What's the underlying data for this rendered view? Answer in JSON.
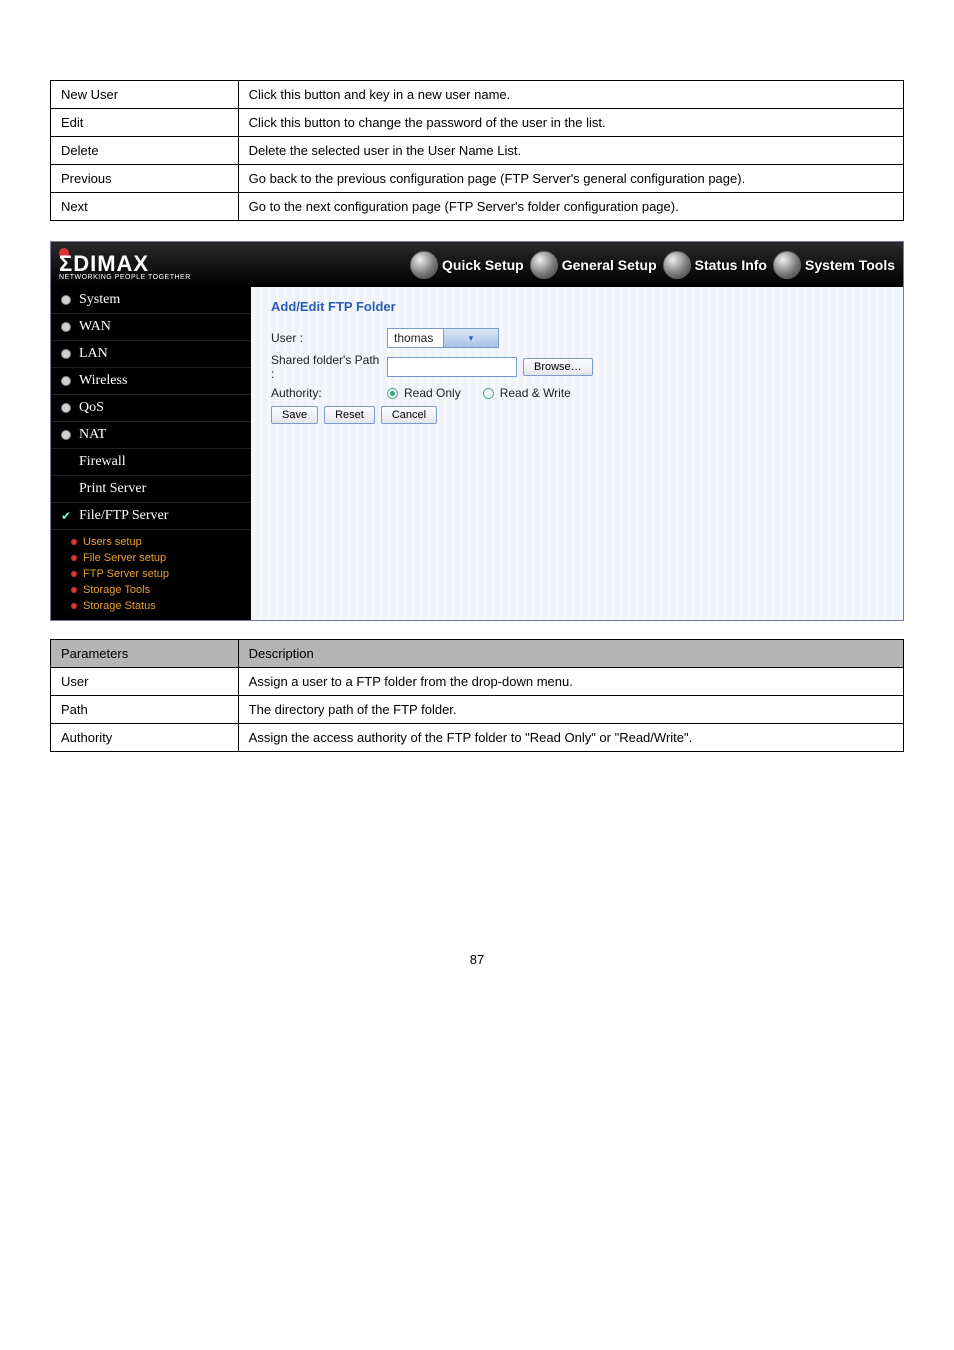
{
  "top_table": {
    "rows": [
      {
        "key": "New User",
        "val": "Click this button and key in a new user name."
      },
      {
        "key": "Edit",
        "val": "Click this button to change the password of the user in the list."
      },
      {
        "key": "Delete",
        "val": "Delete the selected user in the User Name List."
      },
      {
        "key": "Previous",
        "val": "Go back to the previous configuration page (FTP Server's general configuration page)."
      },
      {
        "key": "Next",
        "val": "Go to the next configuration page (FTP Server's folder configuration page)."
      }
    ]
  },
  "brand": {
    "name": "ΣDIMAX",
    "tagline": "NETWORKING PEOPLE TOGETHER"
  },
  "topnav": [
    {
      "label": "Quick Setup"
    },
    {
      "label": "General Setup"
    },
    {
      "label": "Status Info"
    },
    {
      "label": "System Tools"
    }
  ],
  "sidebar": {
    "items": [
      {
        "label": "System"
      },
      {
        "label": "WAN"
      },
      {
        "label": "LAN"
      },
      {
        "label": "Wireless"
      },
      {
        "label": "QoS"
      },
      {
        "label": "NAT"
      },
      {
        "label": "Firewall",
        "plain": true
      },
      {
        "label": "Print Server",
        "plain": true
      },
      {
        "label": "File/FTP Server",
        "active": true
      }
    ],
    "sub": [
      {
        "label": "Users setup"
      },
      {
        "label": "File Server setup"
      },
      {
        "label": "FTP Server setup"
      },
      {
        "label": "Storage Tools"
      },
      {
        "label": "Storage Status"
      }
    ]
  },
  "form": {
    "title": "Add/Edit FTP Folder",
    "user_label": "User :",
    "user_value": "thomas",
    "path_label": "Shared folder's Path :",
    "path_value": "",
    "browse": "Browse…",
    "authority_label": "Authority:",
    "read_only": "Read Only",
    "read_write": "Read & Write",
    "save": "Save",
    "reset": "Reset",
    "cancel": "Cancel"
  },
  "bottom_table": {
    "header": {
      "key": "Parameters",
      "val": "Description"
    },
    "rows": [
      {
        "key": "User",
        "val": "Assign a user to a FTP folder from the drop-down menu."
      },
      {
        "key": "Path",
        "val": "The directory path of the FTP folder."
      },
      {
        "key": "Authority",
        "val": "Assign the access authority of the FTP folder to \"Read Only\" or \"Read/Write\"."
      }
    ]
  },
  "page_number": "87"
}
